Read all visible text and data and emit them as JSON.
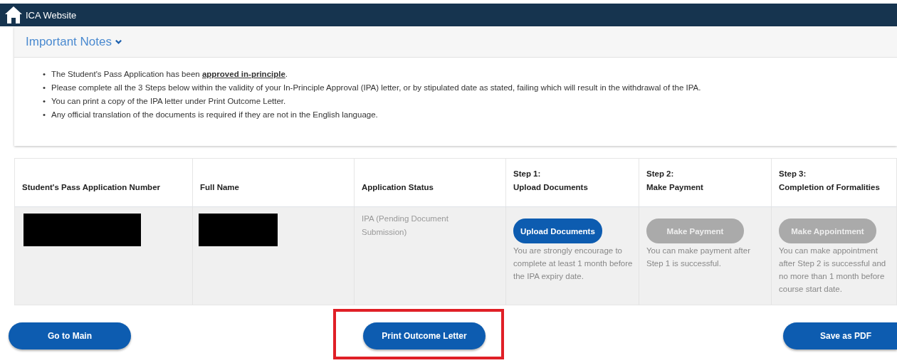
{
  "header": {
    "title": "ICA Website"
  },
  "notes": {
    "title": "Important Notes",
    "expanded": true,
    "items": [
      {
        "bullet": "•",
        "text": "The Student's Pass Application has been **approved in-principle**."
      },
      {
        "bullet": "•",
        "text": "Please complete all the 3 Steps below within the validity of your In-Principle Approval (IPA) letter, or by stipulated date as stated, failing which will result in the withdrawal of the IPA."
      },
      {
        "bullet": "•",
        "text": "You can print a copy of the IPA letter under Print Outcome Letter."
      },
      {
        "bullet": "•",
        "text": "Any official translation of the documents is required if they are not in the English language."
      }
    ]
  },
  "table": {
    "columns": [
      {
        "lines": [
          "Student's Pass Application Number"
        ]
      },
      {
        "lines": [
          "Full Name"
        ]
      },
      {
        "lines": [
          "Application Status"
        ]
      },
      {
        "lines": [
          "Step 1:",
          "Upload Documents"
        ]
      },
      {
        "lines": [
          "Step 2:",
          "Make Payment"
        ]
      },
      {
        "lines": [
          "Step 3:",
          "Completion of Formalities"
        ]
      }
    ],
    "rows": [
      {
        "cells": [
          {
            "kind": "redacted"
          },
          {
            "kind": "redacted"
          },
          {
            "kind": "text",
            "text": "IPA (Pending Document Submission)"
          },
          {
            "kind": "action",
            "button": "Upload Documents",
            "disabled": false,
            "note": "You are strongly encourage to complete at least 1 month before the IPA expiry date."
          },
          {
            "kind": "action",
            "button": "Make Payment",
            "disabled": true,
            "note": "You can make payment after Step 1 is successful."
          },
          {
            "kind": "action",
            "button": "Make Appointment",
            "disabled": true,
            "note": "You can make appointment after Step 2 is successful and no more than 1 month before course start date."
          }
        ]
      }
    ]
  },
  "actions": [
    {
      "label": "Go to Main",
      "highlighted": false
    },
    {
      "label": "Print Outcome Letter",
      "highlighted": true
    },
    {
      "label": "Save as PDF",
      "highlighted": false
    }
  ]
}
